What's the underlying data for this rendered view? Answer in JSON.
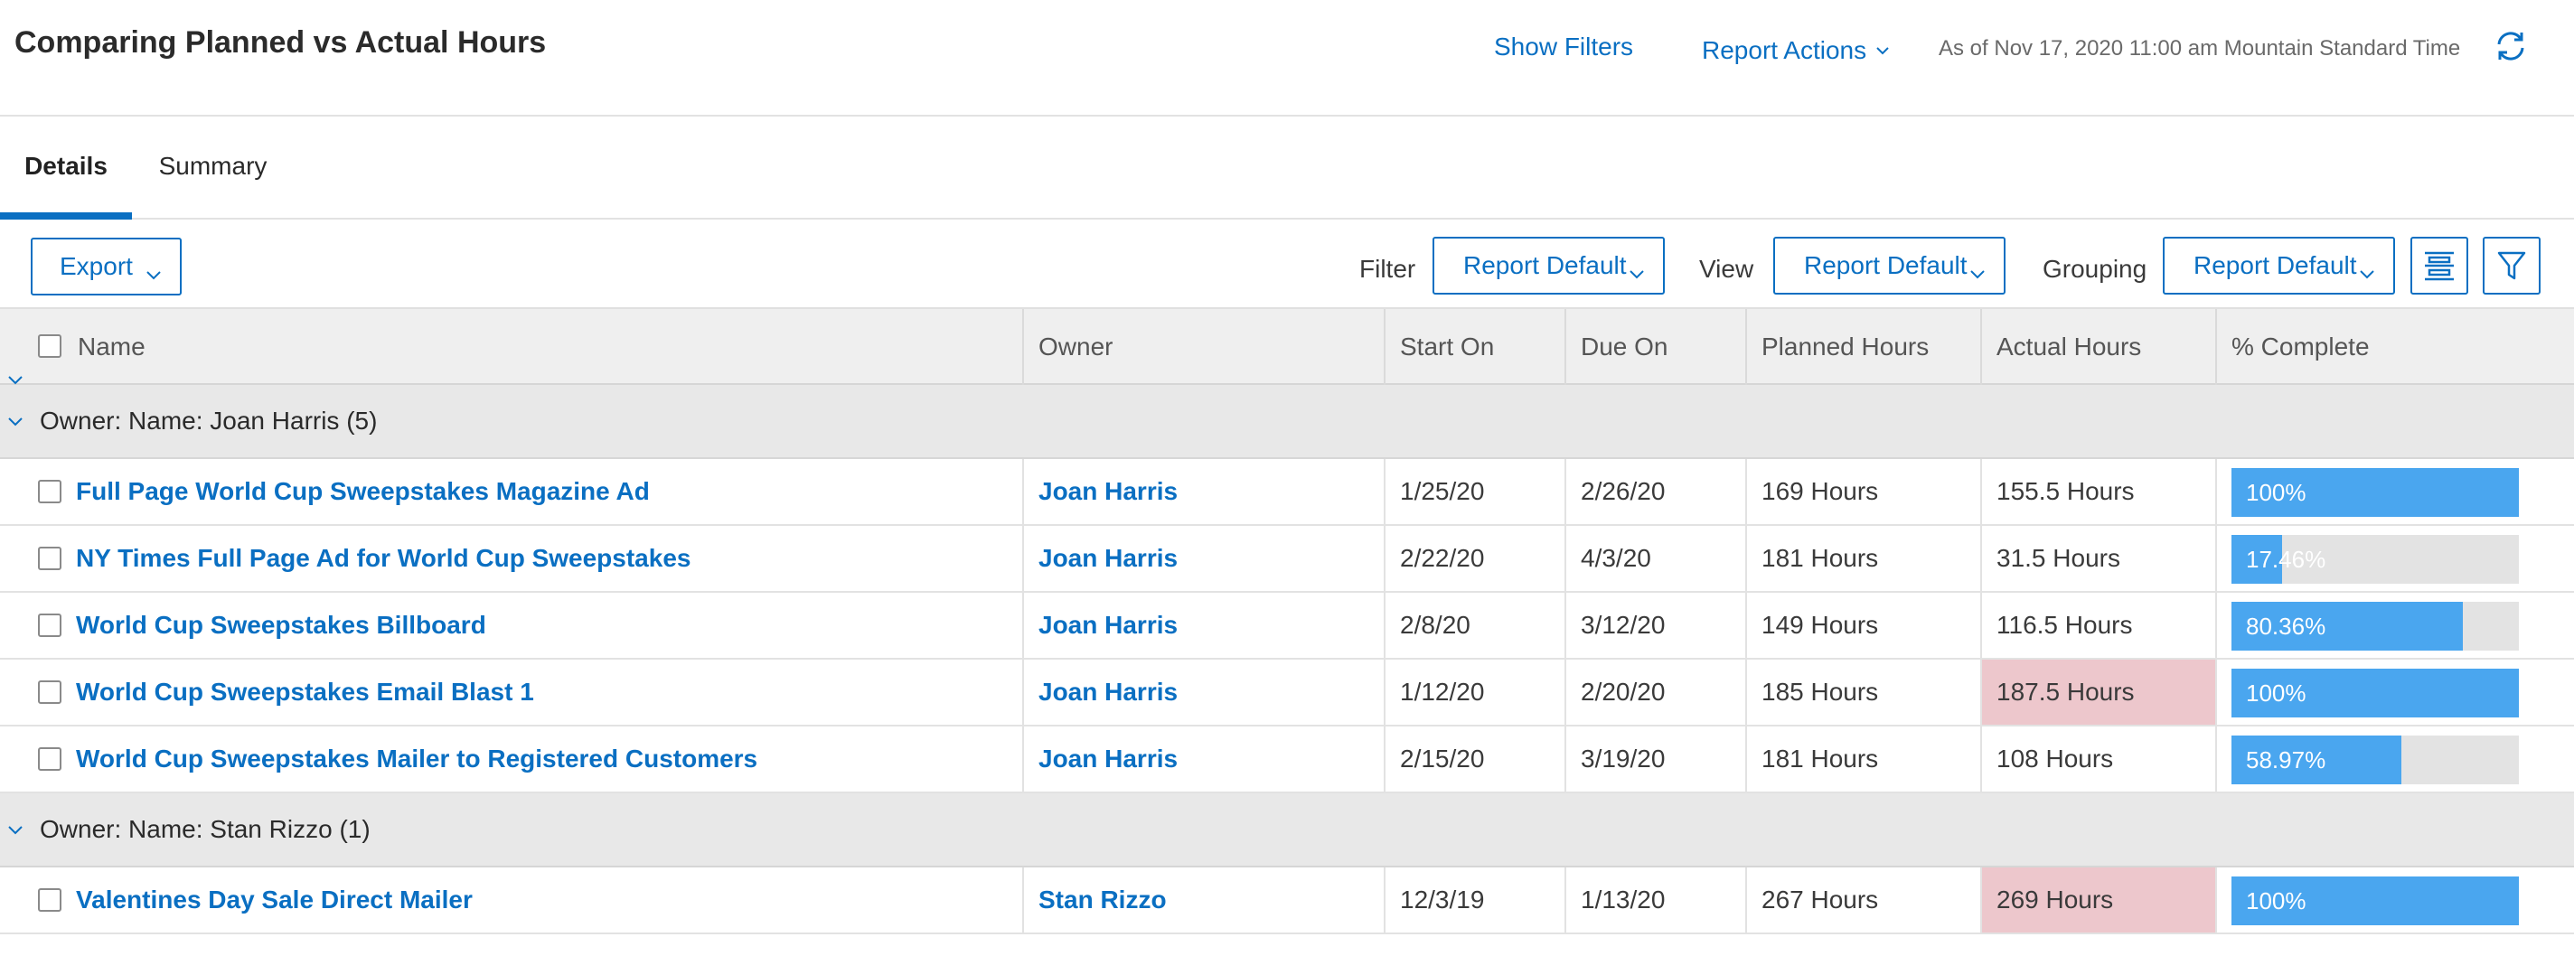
{
  "header": {
    "title": "Comparing Planned vs Actual Hours",
    "show_filters": "Show Filters",
    "report_actions": "Report Actions",
    "as_of": "As of Nov 17, 2020 11:00 am Mountain Standard Time",
    "refresh_icon": "refresh-icon"
  },
  "tabs": [
    {
      "label": "Details",
      "active": true
    },
    {
      "label": "Summary",
      "active": false
    }
  ],
  "toolbar": {
    "export_label": "Export",
    "filter_label": "Filter",
    "filter_value": "Report Default",
    "view_label": "View",
    "view_value": "Report Default",
    "grouping_label": "Grouping",
    "grouping_value": "Report Default",
    "icons": [
      "column-settings-icon",
      "funnel-icon"
    ]
  },
  "table": {
    "columns": [
      "Name",
      "Owner",
      "Start On",
      "Due On",
      "Planned Hours",
      "Actual Hours",
      "% Complete"
    ],
    "groups": [
      {
        "label": "Owner: Name: Joan Harris (5)",
        "rows": [
          {
            "name": "Full Page World Cup Sweepstakes Magazine Ad",
            "owner": "Joan Harris",
            "start": "1/25/20",
            "due": "2/26/20",
            "planned": "169 Hours",
            "actual": "155.5 Hours",
            "over_budget": false,
            "pct_label": "100%",
            "pct": 100
          },
          {
            "name": "NY Times Full Page Ad for World Cup Sweepstakes",
            "owner": "Joan Harris",
            "start": "2/22/20",
            "due": "4/3/20",
            "planned": "181 Hours",
            "actual": "31.5 Hours",
            "over_budget": false,
            "pct_label": "17.46%",
            "pct": 17.46
          },
          {
            "name": "World Cup Sweepstakes Billboard",
            "owner": "Joan Harris",
            "start": "2/8/20",
            "due": "3/12/20",
            "planned": "149 Hours",
            "actual": "116.5 Hours",
            "over_budget": false,
            "pct_label": "80.36%",
            "pct": 80.36
          },
          {
            "name": "World Cup Sweepstakes Email Blast 1",
            "owner": "Joan Harris",
            "start": "1/12/20",
            "due": "2/20/20",
            "planned": "185 Hours",
            "actual": "187.5 Hours",
            "over_budget": true,
            "pct_label": "100%",
            "pct": 100
          },
          {
            "name": "World Cup Sweepstakes Mailer to Registered Customers",
            "owner": "Joan Harris",
            "start": "2/15/20",
            "due": "3/19/20",
            "planned": "181 Hours",
            "actual": "108 Hours",
            "over_budget": false,
            "pct_label": "58.97%",
            "pct": 58.97
          }
        ]
      },
      {
        "label": "Owner: Name: Stan Rizzo (1)",
        "rows": [
          {
            "name": "Valentines Day Sale Direct Mailer",
            "owner": "Stan Rizzo",
            "start": "12/3/19",
            "due": "1/13/20",
            "planned": "267 Hours",
            "actual": "269 Hours",
            "over_budget": true,
            "pct_label": "100%",
            "pct": 100
          }
        ]
      }
    ]
  },
  "colors": {
    "accent": "#0a6fc2",
    "progress_fill": "#4aa6ef",
    "progress_track": "#e3e3e3",
    "over_budget": "#edc7cc"
  }
}
